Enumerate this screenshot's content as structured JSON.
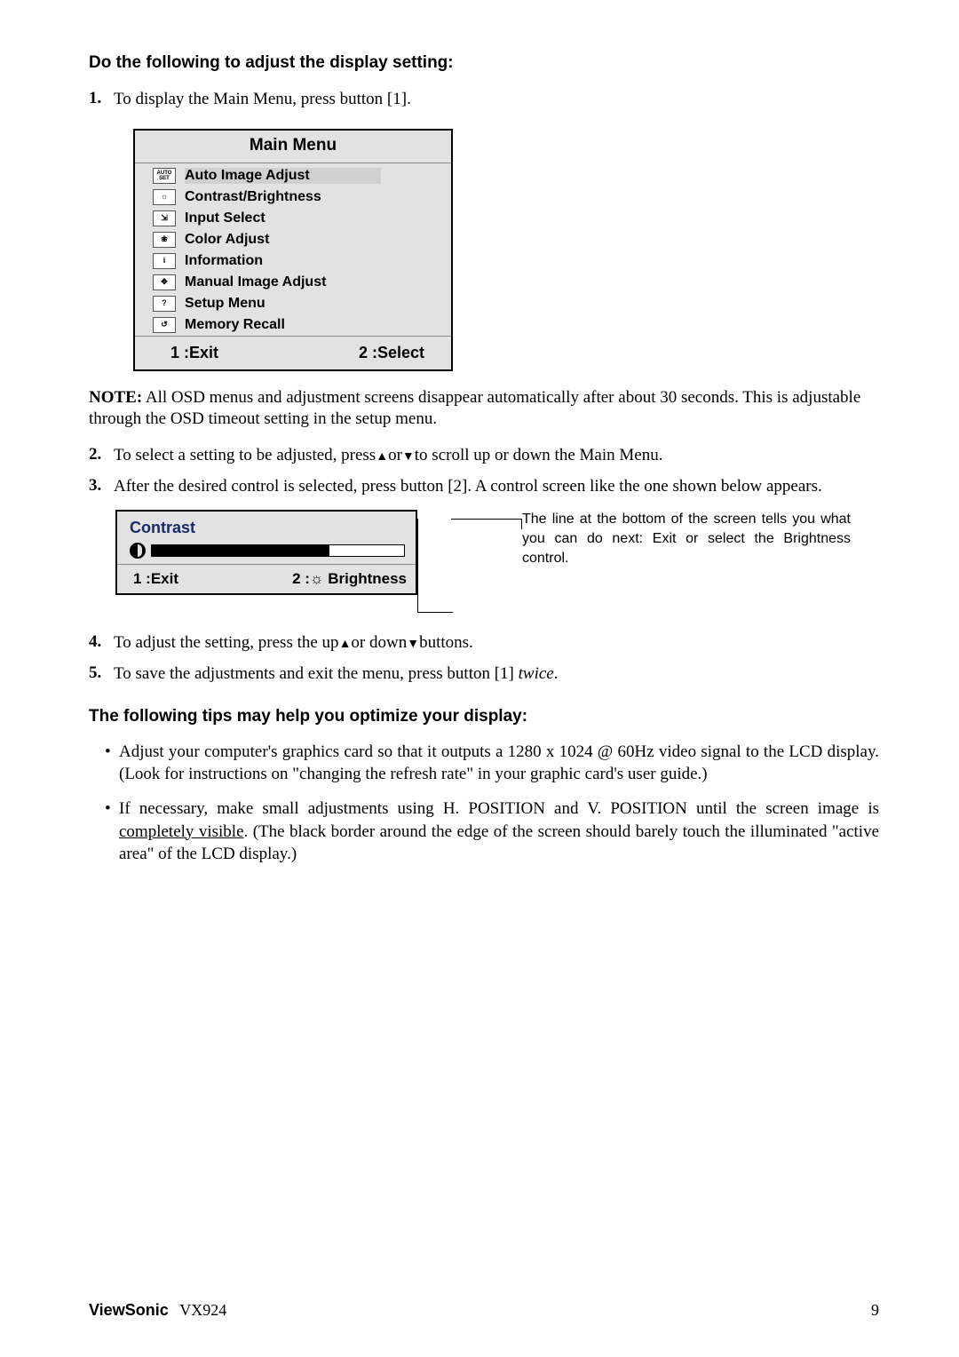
{
  "heading": "Do the following to adjust the display setting:",
  "step1": {
    "num": "1.",
    "text": "To display the Main Menu, press button [1]."
  },
  "mainMenu": {
    "title": "Main Menu",
    "items": [
      {
        "icon": "AUTO SET",
        "label": "Auto Image Adjust"
      },
      {
        "icon": "☼",
        "label": "Contrast/Brightness"
      },
      {
        "icon": "⇲",
        "label": "Input Select"
      },
      {
        "icon": "❀",
        "label": "Color Adjust"
      },
      {
        "icon": "i",
        "label": "Information"
      },
      {
        "icon": "✥",
        "label": "Manual Image Adjust"
      },
      {
        "icon": "?",
        "label": "Setup Menu"
      },
      {
        "icon": "↺",
        "label": "Memory Recall"
      }
    ],
    "footerLeft": "1 :Exit",
    "footerRight": "2 :Select"
  },
  "note": "NOTE: All OSD menus and adjustment screens disappear automatically after about 30 seconds. This is adjustable through the OSD timeout setting in the setup menu.",
  "noteLabel": "NOTE:",
  "noteRest": " All OSD menus and adjustment screens disappear automatically after about 30 seconds. This is adjustable through the OSD timeout setting in the setup menu.",
  "step2": {
    "num": "2.",
    "pre": "To select a setting to be adjusted, press",
    "mid": "or",
    "post": "to scroll up or down the Main Menu."
  },
  "step3": {
    "num": "3.",
    "text": "After the desired control is selected, press button [2]. A control screen like the one shown below appears."
  },
  "contrast": {
    "label": "Contrast",
    "footerLeft": "1 :Exit",
    "footerRight": "2 :☼ Brightness"
  },
  "callout": "The line at the bottom of the screen tells you what you can do next: Exit or select the Brightness control.",
  "step4": {
    "num": "4.",
    "pre": "To adjust the setting, press the up",
    "mid": "or down",
    "post": "buttons."
  },
  "step5": {
    "num": "5.",
    "pre": "To save the adjustments and exit the menu, press button [1] ",
    "em": "twice",
    "post": "."
  },
  "tipsTitle": "The following tips may help you optimize your display:",
  "tip1": "Adjust your computer's graphics card so that it outputs a 1280 x 1024 @ 60Hz video signal to the LCD display. (Look for instructions on \"changing the refresh rate\" in your graphic card's user guide.)",
  "tip2a": "If necessary, make small adjustments using H. POSITION and V. POSITION until the screen image is ",
  "tip2u": "completely visible",
  "tip2b": ". (The black border around the edge of the screen should barely touch the illuminated \"active area\" of the LCD display.)",
  "footer": {
    "brand": "ViewSonic",
    "model": "VX924",
    "page": "9"
  }
}
